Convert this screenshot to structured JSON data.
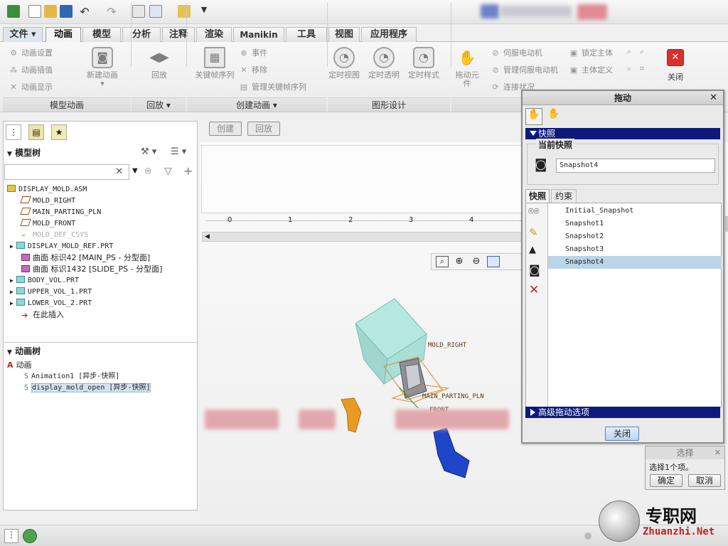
{
  "menu": {
    "file_label": "文件",
    "tabs": [
      "动画",
      "模型",
      "分析",
      "注释",
      "渲染",
      "Manikin",
      "工具",
      "视图",
      "应用程序"
    ]
  },
  "ribbon": {
    "model_anim": {
      "items": [
        "动画设置",
        "动画插值",
        "动画显示"
      ],
      "new_anim_label": "新建动画",
      "group_label": "模型动画"
    },
    "playback": {
      "button_label": "回放",
      "group_label": "回放"
    },
    "create_anim": {
      "keyframe_label": "关键帧序列",
      "event_label": "事件",
      "remove_label": "移除",
      "manage_keyframe_label": "管理关键帧序列",
      "group_label": "创建动画"
    },
    "graphic_design": {
      "timed_view_label": "定时视图",
      "timed_transparency_label": "定时透明",
      "timed_style_label": "定时样式",
      "group_label": "图形设计"
    },
    "mechanism": {
      "drag_element_label": "拖动元件",
      "servo_motor_label": "伺服电动机",
      "manage_servo_label": "管理伺服电动机",
      "connection_status_label": "连接状况",
      "lock_body_label": "锁定主体",
      "body_definition_label": "主体定义"
    },
    "close_label": "关闭"
  },
  "toolbar2": {
    "create_label": "创建",
    "playback_label": "回放"
  },
  "model_tree": {
    "header": "模型树",
    "search_placeholder": "",
    "items": [
      {
        "label": "DISPLAY_MOLD.ASM",
        "icon": "assembly-icon"
      },
      {
        "label": "MOLD_RIGHT",
        "icon": "datum-plane-icon"
      },
      {
        "label": "MAIN_PARTING_PLN",
        "icon": "datum-plane-icon"
      },
      {
        "label": "MOLD_FRONT",
        "icon": "datum-plane-icon"
      },
      {
        "label": "MOLD_DEF_CSYS",
        "icon": "csys-icon"
      },
      {
        "label": "DISPLAY_MOLD_REF.PRT",
        "icon": "part-icon"
      },
      {
        "label": "曲面 标识42 [MAIN_PS - 分型面]",
        "icon": "surface-icon"
      },
      {
        "label": "曲面 标识1432 [SLIDE_PS - 分型面]",
        "icon": "surface-icon"
      },
      {
        "label": "BODY_VOL.PRT",
        "icon": "part-icon"
      },
      {
        "label": "UPPER_VOL_1.PRT",
        "icon": "part-icon"
      },
      {
        "label": "LOWER_VOL_2.PRT",
        "icon": "part-icon"
      },
      {
        "label": "在此插入",
        "icon": "insert-arrow-icon"
      }
    ]
  },
  "animation_tree": {
    "header": "动画树",
    "root": "动画",
    "items": [
      "Animation1 [异步-快照]",
      "display_mold_open [异步-快照]"
    ]
  },
  "ruler": {
    "ticks": [
      "0",
      "1",
      "2",
      "3",
      "4"
    ]
  },
  "canvas_labels": {
    "mold_right": "MOLD_RIGHT",
    "parting_pln": "MAIN_PARTING_PLN",
    "mold_front": "FRONT"
  },
  "drag_dialog": {
    "title": "拖动",
    "snapshot_section": "快照",
    "current_snapshot_label": "当前快照",
    "current_snapshot_value": "Snapshot4",
    "tabs": [
      "快照",
      "约束"
    ],
    "snapshots": [
      "Initial_Snapshot",
      "Snapshot1",
      "Snapshot2",
      "Snapshot3",
      "Snapshot4"
    ],
    "selected_index": 4,
    "advanced_label": "高级拖动选项",
    "close_button": "关闭"
  },
  "select_dialog": {
    "title": "选择",
    "message": "选择1个项。",
    "ok_label": "确定",
    "cancel_label": "取消"
  },
  "watermark": {
    "brand_text": "专职网",
    "url_text": "Zhuanzhi.Net"
  },
  "colors": {
    "selection": "#bcd4ea",
    "section_bar": "#0d1a7c",
    "close_button": "#d9302c"
  }
}
